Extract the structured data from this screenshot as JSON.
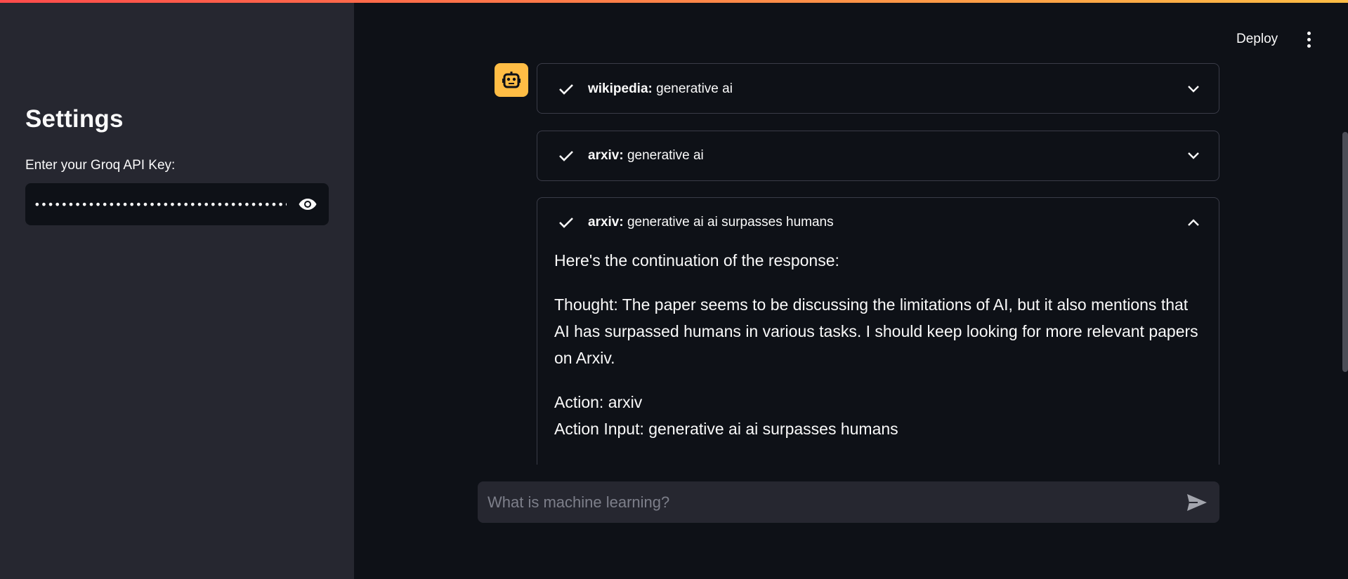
{
  "sidebar": {
    "title": "Settings",
    "api_key_label": "Enter your Groq API Key:",
    "api_key_value": "••••••••••••••••••••••••••••••••••••••••••••••",
    "visibility_icon": "eye-icon"
  },
  "header": {
    "deploy_label": "Deploy",
    "menu_icon": "vertical-dots-icon"
  },
  "chat": {
    "avatar_icon": "robot-icon",
    "avatar_color": "#ffbd45",
    "steps": [
      {
        "tool": "wikipedia:",
        "query": "generative ai",
        "expanded": false
      },
      {
        "tool": "arxiv:",
        "query": "generative ai",
        "expanded": false
      },
      {
        "tool": "arxiv:",
        "query": "generative ai ai surpasses humans",
        "expanded": true,
        "body": {
          "intro": "Here's the continuation of the response:",
          "thought": "Thought: The paper seems to be discussing the limitations of AI, but it also mentions that AI has surpassed humans in various tasks. I should keep looking for more relevant papers on Arxiv.",
          "action": "Action: arxiv",
          "action_input": "Action Input: generative ai ai surpasses humans"
        }
      }
    ]
  },
  "chat_input": {
    "placeholder": "What is machine learning?",
    "send_icon": "send-icon"
  },
  "colors": {
    "background": "#0e1117",
    "sidebar": "#262730",
    "accent": "#ffbd45"
  }
}
